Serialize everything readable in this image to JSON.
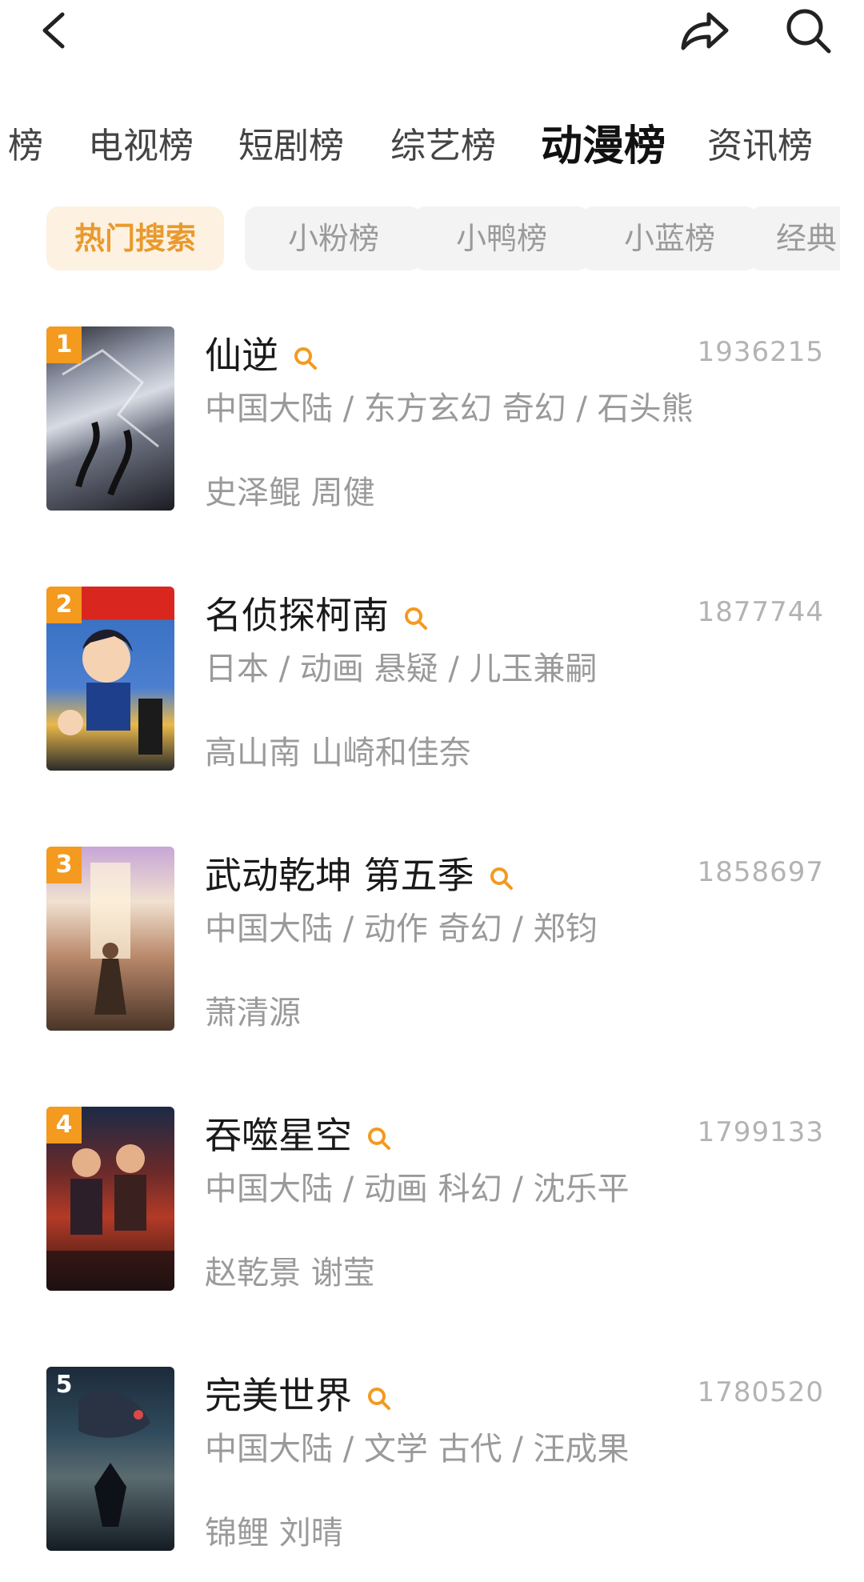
{
  "tabs": [
    "榜",
    "电视榜",
    "短剧榜",
    "综艺榜",
    "动漫榜",
    "资讯榜"
  ],
  "active_tab_index": 4,
  "chips": [
    "热门搜索",
    "小粉榜",
    "小鸭榜",
    "小蓝榜",
    "经典"
  ],
  "active_chip_index": 0,
  "colors": {
    "accent": "#f39a1f",
    "chip_active_bg": "#fdf1e1",
    "chip_active_text": "#e99a2e",
    "muted": "#9a9a9a"
  },
  "icons": {
    "back": "chevron-left-icon",
    "share": "share-arrow-icon",
    "search": "search-icon",
    "hot_search": "magnifier-icon"
  },
  "items": [
    {
      "rank": "1",
      "title": "仙逆",
      "hot": "1936215",
      "meta": "中国大陆 / 东方玄幻 奇幻 / 石头熊",
      "cast": "史泽鲲 周健"
    },
    {
      "rank": "2",
      "title": "名侦探柯南",
      "hot": "1877744",
      "meta": "日本 / 动画 悬疑 / 儿玉兼嗣",
      "cast": "高山南 山崎和佳奈"
    },
    {
      "rank": "3",
      "title": "武动乾坤 第五季",
      "hot": "1858697",
      "meta": "中国大陆 / 动作 奇幻 / 郑钧",
      "cast": "萧清源"
    },
    {
      "rank": "4",
      "title": "吞噬星空",
      "hot": "1799133",
      "meta": "中国大陆 / 动画 科幻 / 沈乐平",
      "cast": "赵乾景 谢莹"
    },
    {
      "rank": "5",
      "title": "完美世界",
      "hot": "1780520",
      "meta": "中国大陆 / 文学 古代 / 汪成果",
      "cast": "锦鲤 刘晴"
    }
  ]
}
